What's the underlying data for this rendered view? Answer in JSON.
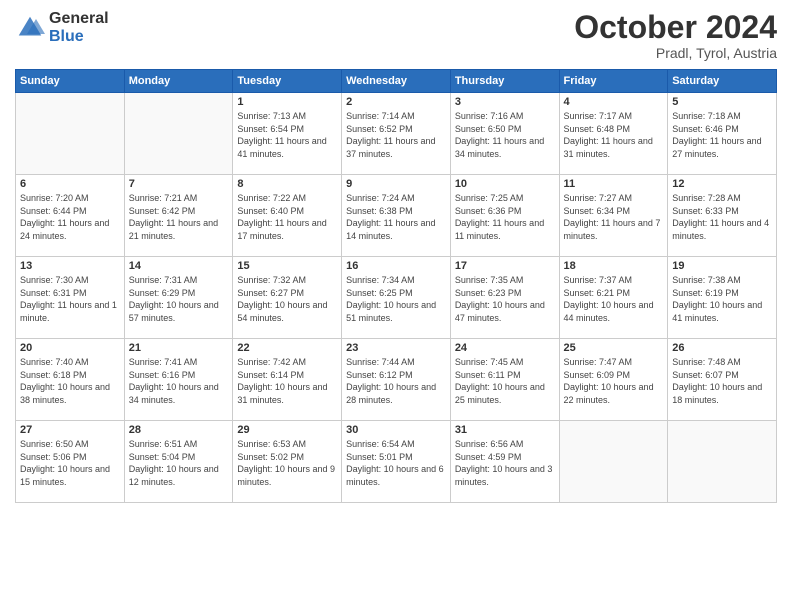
{
  "header": {
    "logo_general": "General",
    "logo_blue": "Blue",
    "month_title": "October 2024",
    "subtitle": "Pradl, Tyrol, Austria"
  },
  "weekdays": [
    "Sunday",
    "Monday",
    "Tuesday",
    "Wednesday",
    "Thursday",
    "Friday",
    "Saturday"
  ],
  "weeks": [
    [
      {
        "day": "",
        "sunrise": "",
        "sunset": "",
        "daylight": ""
      },
      {
        "day": "",
        "sunrise": "",
        "sunset": "",
        "daylight": ""
      },
      {
        "day": "1",
        "sunrise": "Sunrise: 7:13 AM",
        "sunset": "Sunset: 6:54 PM",
        "daylight": "Daylight: 11 hours and 41 minutes."
      },
      {
        "day": "2",
        "sunrise": "Sunrise: 7:14 AM",
        "sunset": "Sunset: 6:52 PM",
        "daylight": "Daylight: 11 hours and 37 minutes."
      },
      {
        "day": "3",
        "sunrise": "Sunrise: 7:16 AM",
        "sunset": "Sunset: 6:50 PM",
        "daylight": "Daylight: 11 hours and 34 minutes."
      },
      {
        "day": "4",
        "sunrise": "Sunrise: 7:17 AM",
        "sunset": "Sunset: 6:48 PM",
        "daylight": "Daylight: 11 hours and 31 minutes."
      },
      {
        "day": "5",
        "sunrise": "Sunrise: 7:18 AM",
        "sunset": "Sunset: 6:46 PM",
        "daylight": "Daylight: 11 hours and 27 minutes."
      }
    ],
    [
      {
        "day": "6",
        "sunrise": "Sunrise: 7:20 AM",
        "sunset": "Sunset: 6:44 PM",
        "daylight": "Daylight: 11 hours and 24 minutes."
      },
      {
        "day": "7",
        "sunrise": "Sunrise: 7:21 AM",
        "sunset": "Sunset: 6:42 PM",
        "daylight": "Daylight: 11 hours and 21 minutes."
      },
      {
        "day": "8",
        "sunrise": "Sunrise: 7:22 AM",
        "sunset": "Sunset: 6:40 PM",
        "daylight": "Daylight: 11 hours and 17 minutes."
      },
      {
        "day": "9",
        "sunrise": "Sunrise: 7:24 AM",
        "sunset": "Sunset: 6:38 PM",
        "daylight": "Daylight: 11 hours and 14 minutes."
      },
      {
        "day": "10",
        "sunrise": "Sunrise: 7:25 AM",
        "sunset": "Sunset: 6:36 PM",
        "daylight": "Daylight: 11 hours and 11 minutes."
      },
      {
        "day": "11",
        "sunrise": "Sunrise: 7:27 AM",
        "sunset": "Sunset: 6:34 PM",
        "daylight": "Daylight: 11 hours and 7 minutes."
      },
      {
        "day": "12",
        "sunrise": "Sunrise: 7:28 AM",
        "sunset": "Sunset: 6:33 PM",
        "daylight": "Daylight: 11 hours and 4 minutes."
      }
    ],
    [
      {
        "day": "13",
        "sunrise": "Sunrise: 7:30 AM",
        "sunset": "Sunset: 6:31 PM",
        "daylight": "Daylight: 11 hours and 1 minute."
      },
      {
        "day": "14",
        "sunrise": "Sunrise: 7:31 AM",
        "sunset": "Sunset: 6:29 PM",
        "daylight": "Daylight: 10 hours and 57 minutes."
      },
      {
        "day": "15",
        "sunrise": "Sunrise: 7:32 AM",
        "sunset": "Sunset: 6:27 PM",
        "daylight": "Daylight: 10 hours and 54 minutes."
      },
      {
        "day": "16",
        "sunrise": "Sunrise: 7:34 AM",
        "sunset": "Sunset: 6:25 PM",
        "daylight": "Daylight: 10 hours and 51 minutes."
      },
      {
        "day": "17",
        "sunrise": "Sunrise: 7:35 AM",
        "sunset": "Sunset: 6:23 PM",
        "daylight": "Daylight: 10 hours and 47 minutes."
      },
      {
        "day": "18",
        "sunrise": "Sunrise: 7:37 AM",
        "sunset": "Sunset: 6:21 PM",
        "daylight": "Daylight: 10 hours and 44 minutes."
      },
      {
        "day": "19",
        "sunrise": "Sunrise: 7:38 AM",
        "sunset": "Sunset: 6:19 PM",
        "daylight": "Daylight: 10 hours and 41 minutes."
      }
    ],
    [
      {
        "day": "20",
        "sunrise": "Sunrise: 7:40 AM",
        "sunset": "Sunset: 6:18 PM",
        "daylight": "Daylight: 10 hours and 38 minutes."
      },
      {
        "day": "21",
        "sunrise": "Sunrise: 7:41 AM",
        "sunset": "Sunset: 6:16 PM",
        "daylight": "Daylight: 10 hours and 34 minutes."
      },
      {
        "day": "22",
        "sunrise": "Sunrise: 7:42 AM",
        "sunset": "Sunset: 6:14 PM",
        "daylight": "Daylight: 10 hours and 31 minutes."
      },
      {
        "day": "23",
        "sunrise": "Sunrise: 7:44 AM",
        "sunset": "Sunset: 6:12 PM",
        "daylight": "Daylight: 10 hours and 28 minutes."
      },
      {
        "day": "24",
        "sunrise": "Sunrise: 7:45 AM",
        "sunset": "Sunset: 6:11 PM",
        "daylight": "Daylight: 10 hours and 25 minutes."
      },
      {
        "day": "25",
        "sunrise": "Sunrise: 7:47 AM",
        "sunset": "Sunset: 6:09 PM",
        "daylight": "Daylight: 10 hours and 22 minutes."
      },
      {
        "day": "26",
        "sunrise": "Sunrise: 7:48 AM",
        "sunset": "Sunset: 6:07 PM",
        "daylight": "Daylight: 10 hours and 18 minutes."
      }
    ],
    [
      {
        "day": "27",
        "sunrise": "Sunrise: 6:50 AM",
        "sunset": "Sunset: 5:06 PM",
        "daylight": "Daylight: 10 hours and 15 minutes."
      },
      {
        "day": "28",
        "sunrise": "Sunrise: 6:51 AM",
        "sunset": "Sunset: 5:04 PM",
        "daylight": "Daylight: 10 hours and 12 minutes."
      },
      {
        "day": "29",
        "sunrise": "Sunrise: 6:53 AM",
        "sunset": "Sunset: 5:02 PM",
        "daylight": "Daylight: 10 hours and 9 minutes."
      },
      {
        "day": "30",
        "sunrise": "Sunrise: 6:54 AM",
        "sunset": "Sunset: 5:01 PM",
        "daylight": "Daylight: 10 hours and 6 minutes."
      },
      {
        "day": "31",
        "sunrise": "Sunrise: 6:56 AM",
        "sunset": "Sunset: 4:59 PM",
        "daylight": "Daylight: 10 hours and 3 minutes."
      },
      {
        "day": "",
        "sunrise": "",
        "sunset": "",
        "daylight": ""
      },
      {
        "day": "",
        "sunrise": "",
        "sunset": "",
        "daylight": ""
      }
    ]
  ]
}
